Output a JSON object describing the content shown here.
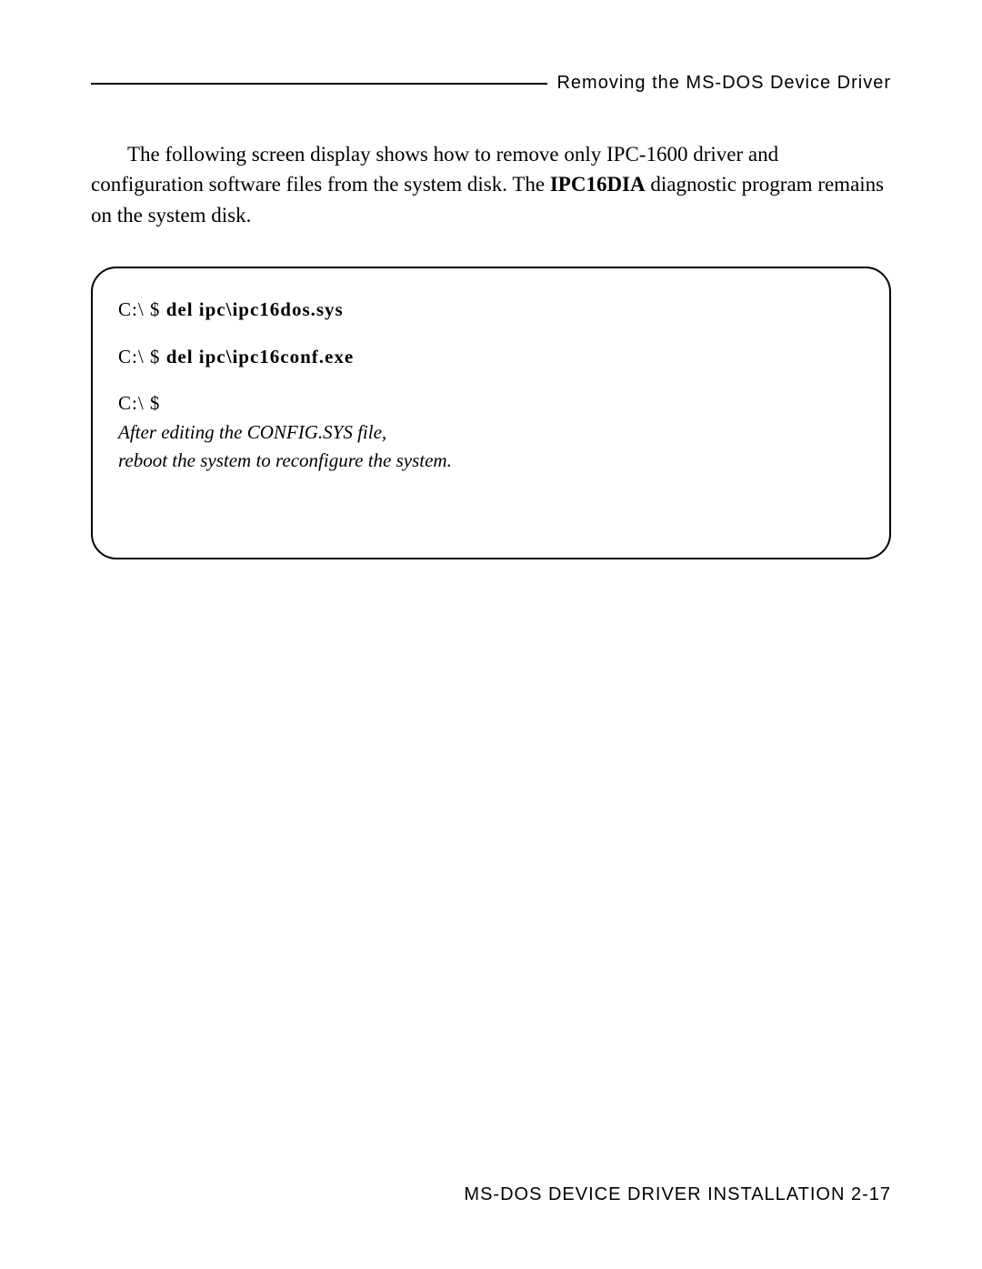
{
  "header": {
    "title": "Removing the MS-DOS Device Driver"
  },
  "body": {
    "paragraph_prefix": "The following screen display shows how to remove only IPC-1600 driver and configuration software files from the system disk. The ",
    "paragraph_bold": "IPC16DIA",
    "paragraph_suffix": " diagnostic program remains on the system disk."
  },
  "terminal": {
    "line1_prompt": "C:\\ $ ",
    "line1_cmd": "del ipc\\ipc16dos.sys",
    "line2_prompt": "C:\\ $ ",
    "line2_cmd": "del ipc\\ipc16conf.exe",
    "line3_prompt": "C:\\ $",
    "note1": "After editing the CONFIG.SYS file,",
    "note2": "reboot the system to reconfigure the system."
  },
  "footer": {
    "text": "MS-DOS DEVICE DRIVER INSTALLATION  2-17"
  }
}
